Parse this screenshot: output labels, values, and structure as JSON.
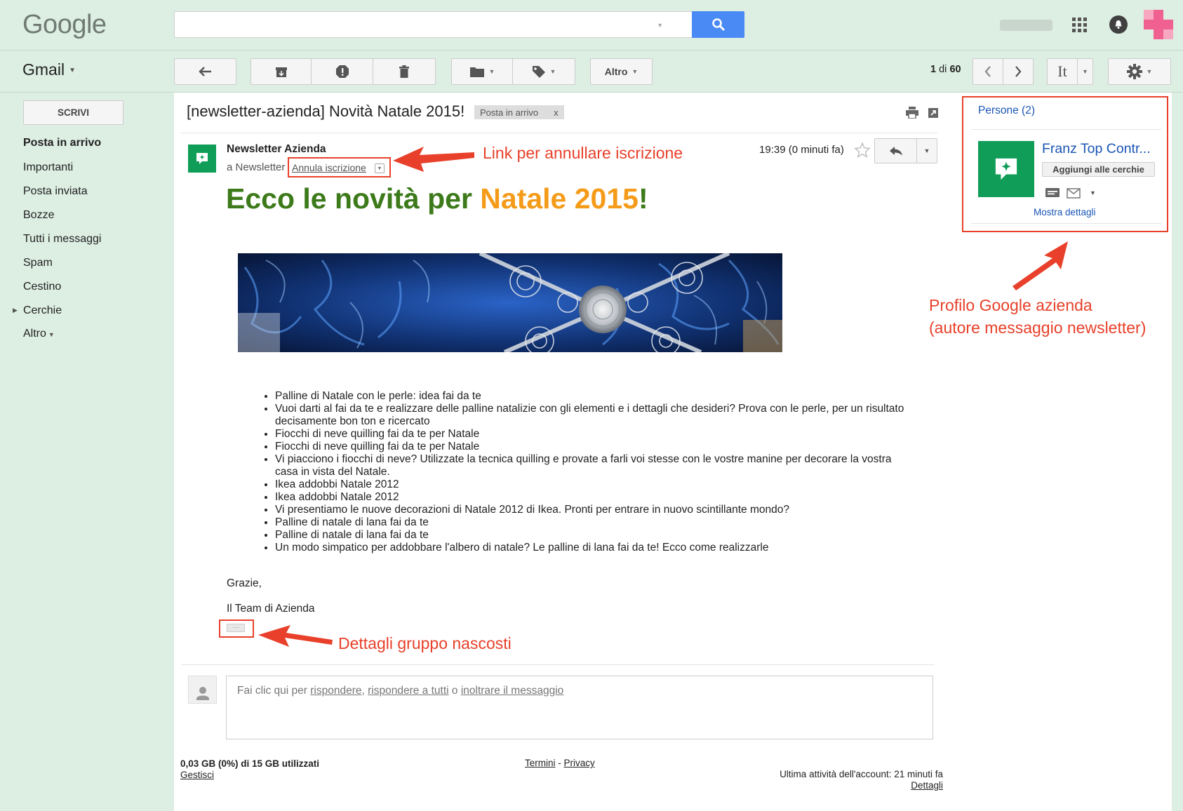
{
  "header": {
    "logo": "Google",
    "search_placeholder": "",
    "search_icon": "search-icon",
    "apps_icon": "apps-grid-icon",
    "notifications_icon": "bell-icon"
  },
  "toolbar": {
    "app_label": "Gmail",
    "altro_label": "Altro",
    "page_prefix": "1",
    "page_of": "di",
    "page_total": "60",
    "lang_label": "It"
  },
  "sidebar": {
    "compose_label": "SCRIVI",
    "items": [
      {
        "label": "Posta in arrivo",
        "active": true
      },
      {
        "label": "Importanti"
      },
      {
        "label": "Posta inviata"
      },
      {
        "label": "Bozze"
      },
      {
        "label": "Tutti i messaggi"
      },
      {
        "label": "Spam"
      },
      {
        "label": "Cestino"
      },
      {
        "label": "Cerchie"
      },
      {
        "label": "Altro"
      }
    ]
  },
  "email": {
    "subject": "[newsletter-azienda] Novità Natale 2015!",
    "label_chip": "Posta in arrivo",
    "label_chip_close": "x",
    "sender_name": "Newsletter Azienda",
    "to_line": "a Newsletter",
    "unsubscribe_label": "Annula iscrizione",
    "time": "19:39 (0 minuti fa)",
    "headline_part1": "Ecco le novità per ",
    "headline_part2": "Natale 2015",
    "headline_part3": "!",
    "bullets": [
      "Palline di Natale con le perle: idea fai da te",
      "Vuoi darti al fai da te e realizzare delle palline natalizie con gli elementi e i dettagli che desideri? Prova con le perle, per un risultato decisamente bon ton e ricercato",
      "Fiocchi di neve quilling fai da te per Natale",
      "Fiocchi di neve quilling fai da te per Natale",
      "Vi piacciono i fiocchi di neve? Utilizzate la tecnica quilling e provate a farli voi stesse con le vostre manine per decorare la vostra casa in vista del Natale.",
      "Ikea addobbi Natale 2012",
      "Ikea addobbi Natale 2012",
      "Vi presentiamo le nuove decorazioni di Natale 2012 di Ikea. Pronti per entrare in nuovo scintillante mondo?",
      "Palline di natale di lana fai da te",
      "Palline di natale di lana fai da te",
      "Un modo simpatico per addobbare l'albero di natale? Le palline di lana fai da te! Ecco come realizzarle"
    ],
    "closing": "Grazie,",
    "signature": "Il Team di Azienda",
    "ellipsis": "···"
  },
  "reply": {
    "prefix": "Fai clic qui per ",
    "reply": "rispondere",
    "sep1": ", ",
    "reply_all": "rispondere a tutti",
    "sep2": " o ",
    "forward": "inoltrare il messaggio"
  },
  "footer": {
    "storage": "0,03 GB (0%) di 15 GB utilizzati",
    "manage": "Gestisci",
    "terms": "Termini",
    "dash": " - ",
    "privacy": "Privacy",
    "last_activity": "Ultima attività dell'account: 21 minuti fa",
    "details": "Dettagli"
  },
  "people": {
    "header": "Persone (2)",
    "name": "Franz Top Contr...",
    "add_button": "Aggiungi alle cerchie",
    "show_details": "Mostra dettagli"
  },
  "annotations": {
    "unsubscribe": "Link per annullare iscrizione",
    "profile_line1": "Profilo Google azienda",
    "profile_line2": "(autore messaggio newsletter)",
    "hidden": "Dettagli gruppo nascosti"
  },
  "colors": {
    "background": "#ddeee3",
    "search_button": "#4a8af4",
    "headline_green": "#3c7a1a",
    "headline_orange": "#f59b1a",
    "annotation_red": "#e8402a",
    "avatar_green": "#0f9d58",
    "link_blue": "#1a55b5"
  }
}
